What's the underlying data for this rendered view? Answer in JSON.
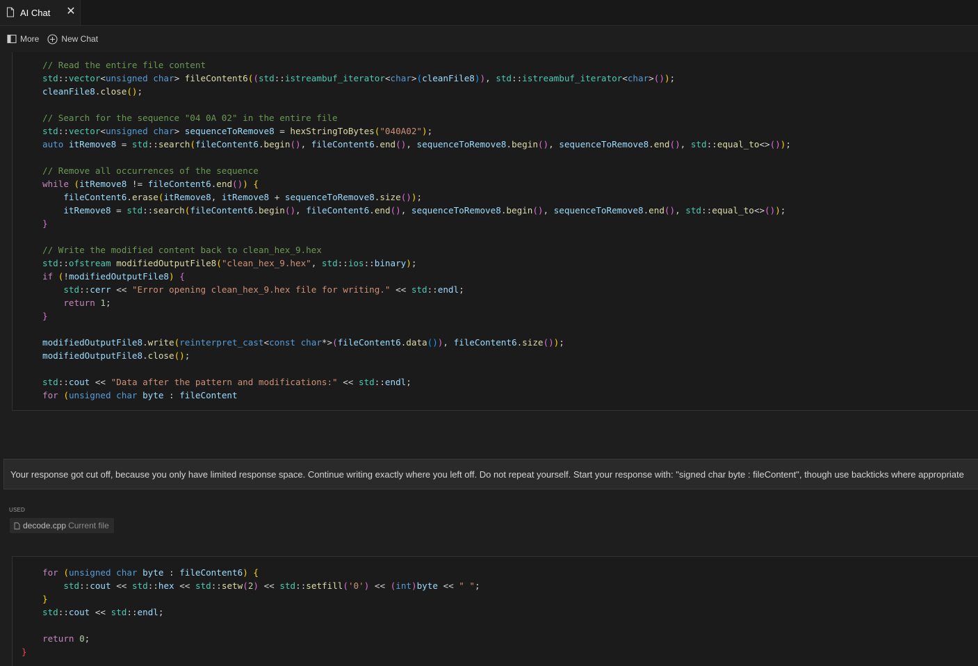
{
  "tab": {
    "title": "AI Chat",
    "close_symbol": "✕"
  },
  "toolbar": {
    "more_label": "More",
    "new_chat_label": "New Chat"
  },
  "code_top": [
    [
      [
        "c-com",
        "// Read the entire file content"
      ]
    ],
    [
      [
        "c-ns",
        "std"
      ],
      [
        "c-op",
        "::"
      ],
      [
        "c-ns",
        "vector"
      ],
      [
        "c-op",
        "<"
      ],
      [
        "c-kw",
        "unsigned char"
      ],
      [
        "c-op",
        "> "
      ],
      [
        "c-fn",
        "fileContent6"
      ],
      [
        "c-p1",
        "("
      ],
      [
        "c-p2",
        "("
      ],
      [
        "c-ns",
        "std"
      ],
      [
        "c-op",
        "::"
      ],
      [
        "c-ns",
        "istreambuf_iterator"
      ],
      [
        "c-op",
        "<"
      ],
      [
        "c-kw",
        "char"
      ],
      [
        "c-op",
        ">"
      ],
      [
        "c-p3",
        "("
      ],
      [
        "c-var",
        "cleanFile8"
      ],
      [
        "c-p3",
        ")"
      ],
      [
        "c-p2",
        ")"
      ],
      [
        "c-op",
        ", "
      ],
      [
        "c-ns",
        "std"
      ],
      [
        "c-op",
        "::"
      ],
      [
        "c-ns",
        "istreambuf_iterator"
      ],
      [
        "c-op",
        "<"
      ],
      [
        "c-kw",
        "char"
      ],
      [
        "c-op",
        ">"
      ],
      [
        "c-p2",
        "()"
      ],
      [
        "c-p1",
        ")"
      ],
      [
        "c-op",
        ";"
      ]
    ],
    [
      [
        "c-var",
        "cleanFile8"
      ],
      [
        "c-op",
        "."
      ],
      [
        "c-fn",
        "close"
      ],
      [
        "c-p1",
        "()"
      ],
      [
        "c-op",
        ";"
      ]
    ],
    [],
    [
      [
        "c-com",
        "// Search for the sequence \"04 0A 02\" in the entire file"
      ]
    ],
    [
      [
        "c-ns",
        "std"
      ],
      [
        "c-op",
        "::"
      ],
      [
        "c-ns",
        "vector"
      ],
      [
        "c-op",
        "<"
      ],
      [
        "c-kw",
        "unsigned char"
      ],
      [
        "c-op",
        "> "
      ],
      [
        "c-var",
        "sequenceToRemove8"
      ],
      [
        "c-op",
        " = "
      ],
      [
        "c-fn",
        "hexStringToBytes"
      ],
      [
        "c-p1",
        "("
      ],
      [
        "c-str",
        "\"040A02\""
      ],
      [
        "c-p1",
        ")"
      ],
      [
        "c-op",
        ";"
      ]
    ],
    [
      [
        "c-kw",
        "auto "
      ],
      [
        "c-var",
        "itRemove8"
      ],
      [
        "c-op",
        " = "
      ],
      [
        "c-ns",
        "std"
      ],
      [
        "c-op",
        "::"
      ],
      [
        "c-fn",
        "search"
      ],
      [
        "c-p1",
        "("
      ],
      [
        "c-var",
        "fileContent6"
      ],
      [
        "c-op",
        "."
      ],
      [
        "c-fn",
        "begin"
      ],
      [
        "c-p2",
        "()"
      ],
      [
        "c-op",
        ", "
      ],
      [
        "c-var",
        "fileContent6"
      ],
      [
        "c-op",
        "."
      ],
      [
        "c-fn",
        "end"
      ],
      [
        "c-p2",
        "()"
      ],
      [
        "c-op",
        ", "
      ],
      [
        "c-var",
        "sequenceToRemove8"
      ],
      [
        "c-op",
        "."
      ],
      [
        "c-fn",
        "begin"
      ],
      [
        "c-p2",
        "()"
      ],
      [
        "c-op",
        ", "
      ],
      [
        "c-var",
        "sequenceToRemove8"
      ],
      [
        "c-op",
        "."
      ],
      [
        "c-fn",
        "end"
      ],
      [
        "c-p2",
        "()"
      ],
      [
        "c-op",
        ", "
      ],
      [
        "c-ns",
        "std"
      ],
      [
        "c-op",
        "::"
      ],
      [
        "c-fn",
        "equal_to"
      ],
      [
        "c-op",
        "<>"
      ],
      [
        "c-p2",
        "()"
      ],
      [
        "c-p1",
        ")"
      ],
      [
        "c-op",
        ";"
      ]
    ],
    [],
    [
      [
        "c-com",
        "// Remove all occurrences of the sequence"
      ]
    ],
    [
      [
        "c-ctl",
        "while "
      ],
      [
        "c-p1",
        "("
      ],
      [
        "c-var",
        "itRemove8"
      ],
      [
        "c-op",
        " != "
      ],
      [
        "c-var",
        "fileContent6"
      ],
      [
        "c-op",
        "."
      ],
      [
        "c-fn",
        "end"
      ],
      [
        "c-p2",
        "()"
      ],
      [
        "c-p1",
        ")"
      ],
      [
        "c-op",
        " "
      ],
      [
        "c-p1",
        "{"
      ]
    ],
    [
      [
        "c-op",
        "    "
      ],
      [
        "c-var",
        "fileContent6"
      ],
      [
        "c-op",
        "."
      ],
      [
        "c-fn",
        "erase"
      ],
      [
        "c-p1",
        "("
      ],
      [
        "c-var",
        "itRemove8"
      ],
      [
        "c-op",
        ", "
      ],
      [
        "c-var",
        "itRemove8"
      ],
      [
        "c-op",
        " + "
      ],
      [
        "c-var",
        "sequenceToRemove8"
      ],
      [
        "c-op",
        "."
      ],
      [
        "c-fn",
        "size"
      ],
      [
        "c-p2",
        "()"
      ],
      [
        "c-p1",
        ")"
      ],
      [
        "c-op",
        ";"
      ]
    ],
    [
      [
        "c-op",
        "    "
      ],
      [
        "c-var",
        "itRemove8"
      ],
      [
        "c-op",
        " = "
      ],
      [
        "c-ns",
        "std"
      ],
      [
        "c-op",
        "::"
      ],
      [
        "c-fn",
        "search"
      ],
      [
        "c-p1",
        "("
      ],
      [
        "c-var",
        "fileContent6"
      ],
      [
        "c-op",
        "."
      ],
      [
        "c-fn",
        "begin"
      ],
      [
        "c-p2",
        "()"
      ],
      [
        "c-op",
        ", "
      ],
      [
        "c-var",
        "fileContent6"
      ],
      [
        "c-op",
        "."
      ],
      [
        "c-fn",
        "end"
      ],
      [
        "c-p2",
        "()"
      ],
      [
        "c-op",
        ", "
      ],
      [
        "c-var",
        "sequenceToRemove8"
      ],
      [
        "c-op",
        "."
      ],
      [
        "c-fn",
        "begin"
      ],
      [
        "c-p2",
        "()"
      ],
      [
        "c-op",
        ", "
      ],
      [
        "c-var",
        "sequenceToRemove8"
      ],
      [
        "c-op",
        "."
      ],
      [
        "c-fn",
        "end"
      ],
      [
        "c-p2",
        "()"
      ],
      [
        "c-op",
        ", "
      ],
      [
        "c-ns",
        "std"
      ],
      [
        "c-op",
        "::"
      ],
      [
        "c-fn",
        "equal_to"
      ],
      [
        "c-op",
        "<>"
      ],
      [
        "c-p2",
        "()"
      ],
      [
        "c-p1",
        ")"
      ],
      [
        "c-op",
        ";"
      ]
    ],
    [
      [
        "c-p2",
        "}"
      ]
    ],
    [],
    [
      [
        "c-com",
        "// Write the modified content back to clean_hex_9.hex"
      ]
    ],
    [
      [
        "c-ns",
        "std"
      ],
      [
        "c-op",
        "::"
      ],
      [
        "c-ns",
        "ofstream"
      ],
      [
        "c-op",
        " "
      ],
      [
        "c-fn",
        "modifiedOutputFile8"
      ],
      [
        "c-p1",
        "("
      ],
      [
        "c-str",
        "\"clean_hex_9.hex\""
      ],
      [
        "c-op",
        ", "
      ],
      [
        "c-ns",
        "std"
      ],
      [
        "c-op",
        "::"
      ],
      [
        "c-ns",
        "ios"
      ],
      [
        "c-op",
        "::"
      ],
      [
        "c-var",
        "binary"
      ],
      [
        "c-p1",
        ")"
      ],
      [
        "c-op",
        ";"
      ]
    ],
    [
      [
        "c-ctl",
        "if "
      ],
      [
        "c-p1",
        "("
      ],
      [
        "c-op",
        "!"
      ],
      [
        "c-var",
        "modifiedOutputFile8"
      ],
      [
        "c-p1",
        ")"
      ],
      [
        "c-op",
        " "
      ],
      [
        "c-p2",
        "{"
      ]
    ],
    [
      [
        "c-op",
        "    "
      ],
      [
        "c-ns",
        "std"
      ],
      [
        "c-op",
        "::"
      ],
      [
        "c-var",
        "cerr"
      ],
      [
        "c-op",
        " << "
      ],
      [
        "c-str",
        "\"Error opening clean_hex_9.hex file for writing.\""
      ],
      [
        "c-op",
        " << "
      ],
      [
        "c-ns",
        "std"
      ],
      [
        "c-op",
        "::"
      ],
      [
        "c-var",
        "endl"
      ],
      [
        "c-op",
        ";"
      ]
    ],
    [
      [
        "c-op",
        "    "
      ],
      [
        "c-ctl",
        "return "
      ],
      [
        "c-num",
        "1"
      ],
      [
        "c-op",
        ";"
      ]
    ],
    [
      [
        "c-p2",
        "}"
      ]
    ],
    [],
    [
      [
        "c-var",
        "modifiedOutputFile8"
      ],
      [
        "c-op",
        "."
      ],
      [
        "c-fn",
        "write"
      ],
      [
        "c-p1",
        "("
      ],
      [
        "c-kw",
        "reinterpret_cast"
      ],
      [
        "c-op",
        "<"
      ],
      [
        "c-kw",
        "const char"
      ],
      [
        "c-op",
        "*>"
      ],
      [
        "c-p2",
        "("
      ],
      [
        "c-var",
        "fileContent6"
      ],
      [
        "c-op",
        "."
      ],
      [
        "c-fn",
        "data"
      ],
      [
        "c-p3",
        "()"
      ],
      [
        "c-p2",
        ")"
      ],
      [
        "c-op",
        ", "
      ],
      [
        "c-var",
        "fileContent6"
      ],
      [
        "c-op",
        "."
      ],
      [
        "c-fn",
        "size"
      ],
      [
        "c-p2",
        "()"
      ],
      [
        "c-p1",
        ")"
      ],
      [
        "c-op",
        ";"
      ]
    ],
    [
      [
        "c-var",
        "modifiedOutputFile8"
      ],
      [
        "c-op",
        "."
      ],
      [
        "c-fn",
        "close"
      ],
      [
        "c-p1",
        "()"
      ],
      [
        "c-op",
        ";"
      ]
    ],
    [],
    [
      [
        "c-ns",
        "std"
      ],
      [
        "c-op",
        "::"
      ],
      [
        "c-var",
        "cout"
      ],
      [
        "c-op",
        " << "
      ],
      [
        "c-str",
        "\"Data after the pattern and modifications:\""
      ],
      [
        "c-op",
        " << "
      ],
      [
        "c-ns",
        "std"
      ],
      [
        "c-op",
        "::"
      ],
      [
        "c-var",
        "endl"
      ],
      [
        "c-op",
        ";"
      ]
    ],
    [
      [
        "c-ctl",
        "for "
      ],
      [
        "c-p1",
        "("
      ],
      [
        "c-kw",
        "unsigned char "
      ],
      [
        "c-var",
        "byte"
      ],
      [
        "c-op",
        " : "
      ],
      [
        "c-var",
        "fileContent"
      ]
    ]
  ],
  "user_message": "Your response got cut off, because you only have limited response space. Continue writing exactly where you left off. Do not repeat yourself. Start your response with: \"signed char byte : fileContent\", though use backticks where appropriate",
  "context": {
    "used_label": "USED",
    "file_name": "decode.cpp",
    "file_note": "Current file"
  },
  "code_bottom": [
    [
      [
        "c-ctl",
        "for "
      ],
      [
        "c-p1",
        "("
      ],
      [
        "c-kw",
        "unsigned char "
      ],
      [
        "c-var",
        "byte"
      ],
      [
        "c-op",
        " : "
      ],
      [
        "c-var",
        "fileContent6"
      ],
      [
        "c-p1",
        ")"
      ],
      [
        "c-op",
        " "
      ],
      [
        "c-p1",
        "{"
      ]
    ],
    [
      [
        "c-op",
        "    "
      ],
      [
        "c-ns",
        "std"
      ],
      [
        "c-op",
        "::"
      ],
      [
        "c-var",
        "cout"
      ],
      [
        "c-op",
        " << "
      ],
      [
        "c-ns",
        "std"
      ],
      [
        "c-op",
        "::"
      ],
      [
        "c-var",
        "hex"
      ],
      [
        "c-op",
        " << "
      ],
      [
        "c-ns",
        "std"
      ],
      [
        "c-op",
        "::"
      ],
      [
        "c-fn",
        "setw"
      ],
      [
        "c-p2",
        "("
      ],
      [
        "c-num",
        "2"
      ],
      [
        "c-p2",
        ")"
      ],
      [
        "c-op",
        " << "
      ],
      [
        "c-ns",
        "std"
      ],
      [
        "c-op",
        "::"
      ],
      [
        "c-fn",
        "setfill"
      ],
      [
        "c-p2",
        "("
      ],
      [
        "c-str",
        "'0'"
      ],
      [
        "c-p2",
        ")"
      ],
      [
        "c-op",
        " << "
      ],
      [
        "c-p2",
        "("
      ],
      [
        "c-kw",
        "int"
      ],
      [
        "c-p2",
        ")"
      ],
      [
        "c-var",
        "byte"
      ],
      [
        "c-op",
        " << "
      ],
      [
        "c-str",
        "\" \""
      ],
      [
        "c-op",
        ";"
      ]
    ],
    [
      [
        "c-p1",
        "}"
      ]
    ],
    [
      [
        "c-ns",
        "std"
      ],
      [
        "c-op",
        "::"
      ],
      [
        "c-var",
        "cout"
      ],
      [
        "c-op",
        " << "
      ],
      [
        "c-ns",
        "std"
      ],
      [
        "c-op",
        "::"
      ],
      [
        "c-var",
        "endl"
      ],
      [
        "c-op",
        ";"
      ]
    ],
    [],
    [
      [
        "c-ctl",
        "return "
      ],
      [
        "c-num",
        "0"
      ],
      [
        "c-op",
        ";"
      ]
    ],
    [
      [
        "c-red",
        "}"
      ]
    ]
  ]
}
